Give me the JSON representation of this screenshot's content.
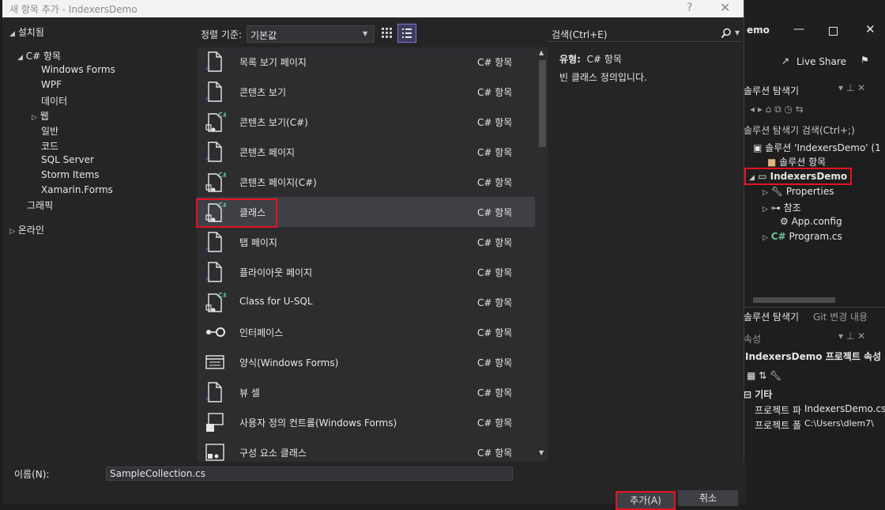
{
  "dialog": {
    "title": "새 항목 추가 - IndexersDemo",
    "help": "?",
    "close": "✕"
  },
  "left_tree": {
    "installed": "설치됨",
    "csharp_items": "C# 항목",
    "children": [
      "Windows Forms",
      "WPF",
      "데이터",
      "웹",
      "일반",
      "코드",
      "SQL Server",
      "Storm Items",
      "Xamarin.Forms"
    ],
    "graphics": "그래픽",
    "online": "온라인"
  },
  "sort": {
    "label": "정렬 기준:",
    "value": "기본값"
  },
  "search": {
    "placeholder": "검색(Ctrl+E)"
  },
  "templates": [
    {
      "name": "목록 보기 페이지",
      "type": "C# 항목",
      "icon": "page-icon"
    },
    {
      "name": "콘텐츠 보기",
      "type": "C# 항목",
      "icon": "page-icon"
    },
    {
      "name": "콘텐츠 보기(C#)",
      "type": "C# 항목",
      "icon": "csharp-class-icon"
    },
    {
      "name": "콘텐츠 페이지",
      "type": "C# 항목",
      "icon": "page-icon"
    },
    {
      "name": "콘텐츠 페이지(C#)",
      "type": "C# 항목",
      "icon": "csharp-class-icon"
    },
    {
      "name": "클래스",
      "type": "C# 항목",
      "icon": "csharp-class-icon"
    },
    {
      "name": "탭 페이지",
      "type": "C# 항목",
      "icon": "page-icon"
    },
    {
      "name": "플라이아웃 페이지",
      "type": "C# 항목",
      "icon": "page-icon"
    },
    {
      "name": "Class for U-SQL",
      "type": "C# 항목",
      "icon": "csharp-class-icon"
    },
    {
      "name": "인터페이스",
      "type": "C# 항목",
      "icon": "interface-icon"
    },
    {
      "name": "양식(Windows Forms)",
      "type": "C# 항목",
      "icon": "form-icon"
    },
    {
      "name": "뷰 셀",
      "type": "C# 항목",
      "icon": "page-icon"
    },
    {
      "name": "사용자 정의 컨트롤(Windows Forms)",
      "type": "C# 항목",
      "icon": "usercontrol-icon"
    },
    {
      "name": "구성 요소 클래스",
      "type": "C# 항목",
      "icon": "component-icon"
    }
  ],
  "details": {
    "type_label": "유형:",
    "type_value": "C# 항목",
    "description": "빈 클래스 정의입니다."
  },
  "bottom": {
    "name_label": "이름(N):",
    "name_value": "SampleCollection.cs",
    "add_button": "추가(A)",
    "cancel_button": "취소"
  },
  "vs": {
    "title_fragment": "emo",
    "live_share": "Live Share",
    "solution_explorer_title": "솔루션 탐색기",
    "se_search": "솔루션 탐색기 검색(Ctrl+;)",
    "solution_node": "솔루션 'IndexersDemo' (1",
    "solution_items": "솔루션 항목",
    "project": "IndexersDemo",
    "properties": "Properties",
    "references": "참조",
    "app_config": "App.config",
    "program_cs": "Program.cs",
    "tab_se": "솔루션 탐색기",
    "tab_git": "Git 변경 내용",
    "props_title": "속성",
    "props_object": "IndexersDemo 프로젝트 속성",
    "props_category": "기타",
    "props_row1_name": "프로젝트 파",
    "props_row1_value": "IndexersDemo.csp",
    "props_row2_name": "프로젝트 폴",
    "props_row2_value": "C:\\Users\\dlem7\\"
  },
  "colors": {
    "highlight": "#e81123",
    "accent": "#7f73d3"
  }
}
